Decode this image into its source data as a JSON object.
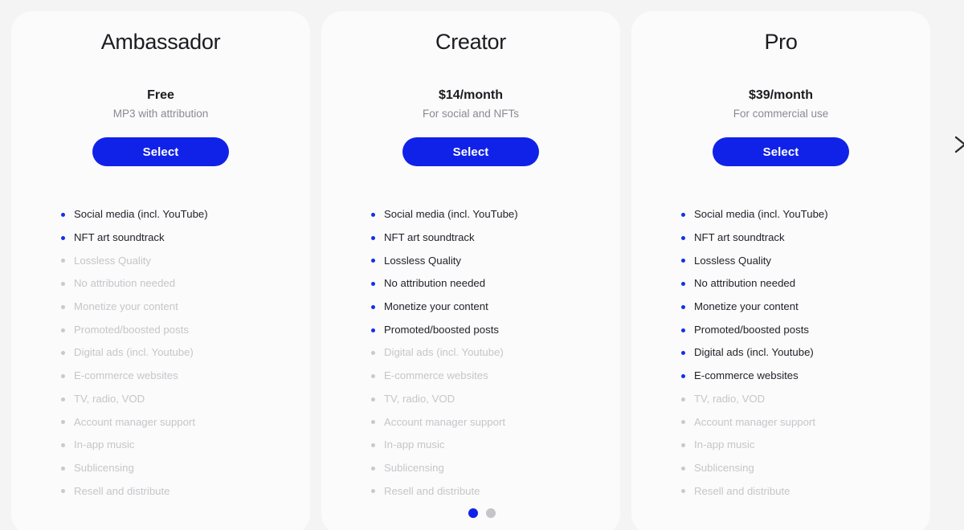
{
  "plans": [
    {
      "title": "Ambassador",
      "price": "Free",
      "caption": "MP3 with attribution",
      "cta": "Select",
      "features": [
        {
          "label": "Social media (incl. YouTube)",
          "included": true
        },
        {
          "label": "NFT art soundtrack",
          "included": true
        },
        {
          "label": "Lossless Quality",
          "included": false
        },
        {
          "label": "No attribution needed",
          "included": false
        },
        {
          "label": "Monetize your content",
          "included": false
        },
        {
          "label": "Promoted/boosted posts",
          "included": false
        },
        {
          "label": "Digital ads (incl. Youtube)",
          "included": false
        },
        {
          "label": "E-commerce websites",
          "included": false
        },
        {
          "label": "TV, radio, VOD",
          "included": false
        },
        {
          "label": "Account manager support",
          "included": false
        },
        {
          "label": "In-app music",
          "included": false
        },
        {
          "label": "Sublicensing",
          "included": false
        },
        {
          "label": "Resell and distribute",
          "included": false
        }
      ]
    },
    {
      "title": "Creator",
      "price": "$14/month",
      "caption": "For social and NFTs",
      "cta": "Select",
      "features": [
        {
          "label": "Social media (incl. YouTube)",
          "included": true
        },
        {
          "label": "NFT art soundtrack",
          "included": true
        },
        {
          "label": "Lossless Quality",
          "included": true
        },
        {
          "label": "No attribution needed",
          "included": true
        },
        {
          "label": "Monetize your content",
          "included": true
        },
        {
          "label": "Promoted/boosted posts",
          "included": true
        },
        {
          "label": "Digital ads (incl. Youtube)",
          "included": false
        },
        {
          "label": "E-commerce websites",
          "included": false
        },
        {
          "label": "TV, radio, VOD",
          "included": false
        },
        {
          "label": "Account manager support",
          "included": false
        },
        {
          "label": "In-app music",
          "included": false
        },
        {
          "label": "Sublicensing",
          "included": false
        },
        {
          "label": "Resell and distribute",
          "included": false
        }
      ]
    },
    {
      "title": "Pro",
      "price": "$39/month",
      "caption": "For commercial use",
      "cta": "Select",
      "features": [
        {
          "label": "Social media (incl. YouTube)",
          "included": true
        },
        {
          "label": "NFT art soundtrack",
          "included": true
        },
        {
          "label": "Lossless Quality",
          "included": true
        },
        {
          "label": "No attribution needed",
          "included": true
        },
        {
          "label": "Monetize your content",
          "included": true
        },
        {
          "label": "Promoted/boosted posts",
          "included": true
        },
        {
          "label": "Digital ads (incl. Youtube)",
          "included": true
        },
        {
          "label": "E-commerce websites",
          "included": true
        },
        {
          "label": "TV, radio, VOD",
          "included": false
        },
        {
          "label": "Account manager support",
          "included": false
        },
        {
          "label": "In-app music",
          "included": false
        },
        {
          "label": "Sublicensing",
          "included": false
        },
        {
          "label": "Resell and distribute",
          "included": false
        }
      ]
    }
  ],
  "carousel": {
    "dots": [
      {
        "active": true
      },
      {
        "active": false
      }
    ],
    "next_icon": "chevron-right-icon"
  },
  "colors": {
    "accent": "#1022e8",
    "bullet_on": "#1230ea",
    "bullet_off": "#c9c9ce",
    "text_on": "#22222a",
    "text_off": "#c6c6cb",
    "card_bg": "#fbfbfb",
    "page_bg": "#f4f4f5"
  }
}
